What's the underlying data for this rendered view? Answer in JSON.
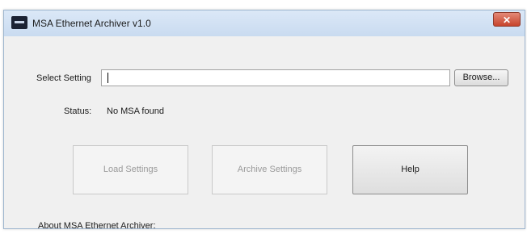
{
  "window": {
    "title": "MSA Ethernet Archiver v1.0",
    "close_glyph": "✕",
    "app_icon": "app-icon"
  },
  "form": {
    "select_setting_label": "Select Setting",
    "path_value": "",
    "browse_label": "Browse...",
    "status_label": "Status:",
    "status_value": "No MSA found"
  },
  "buttons": {
    "load_settings": "Load Settings",
    "archive_settings": "Archive Settings",
    "help": "Help"
  },
  "footer": {
    "about_label": "About MSA Ethernet Archiver:"
  },
  "colors": {
    "titlebar": "#dbe8f7",
    "close": "#c7442c",
    "client": "#f0f0f0"
  }
}
